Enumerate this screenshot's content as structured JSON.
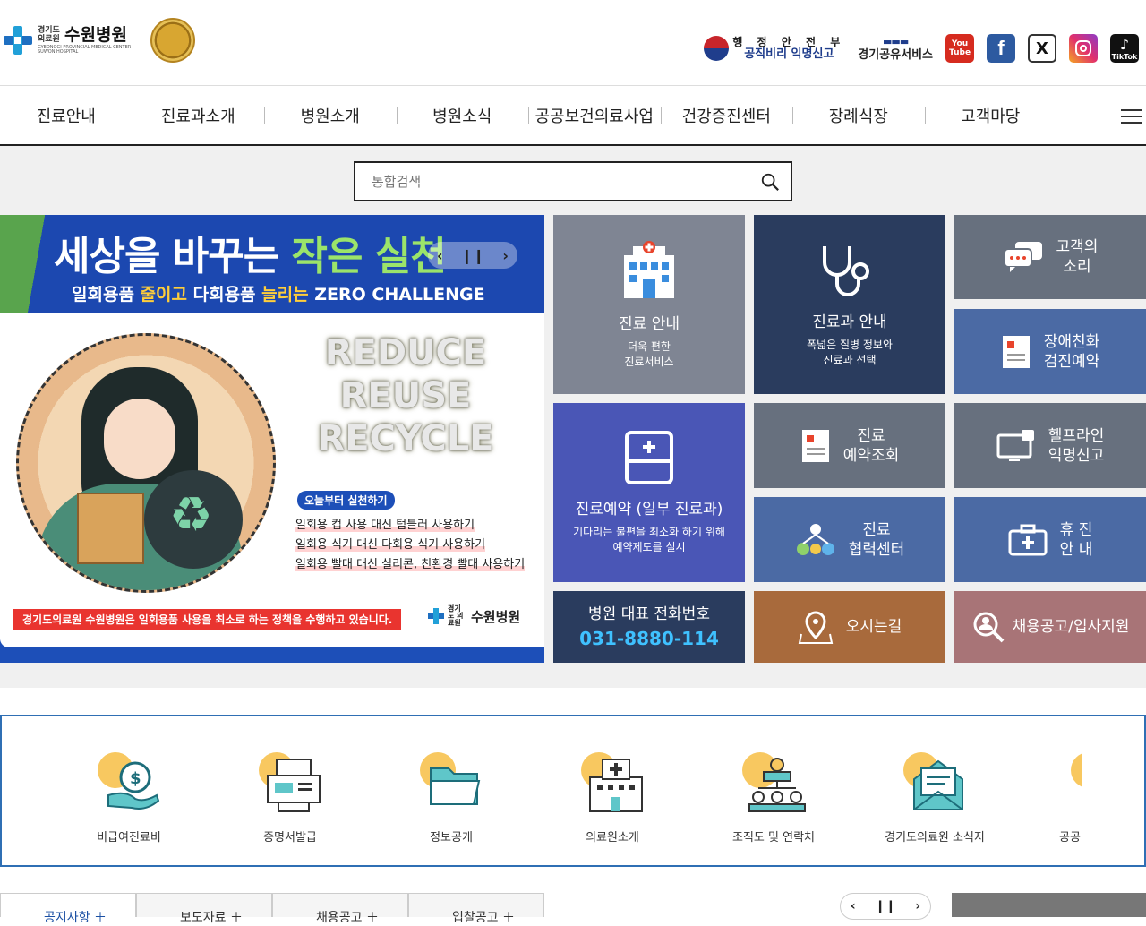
{
  "header": {
    "logo_small": "경기도 의료원",
    "logo_big": "수원병원",
    "logo_en": "GYEONGGI PROVINCIAL MEDICAL CENTER SUWON HOSPITAL",
    "gov_line1": "행 정 안 전 부",
    "gov_line2": "공직비리 익명신고",
    "share_label": "경기공유서비스",
    "youtube": "You Tube",
    "facebook": "f",
    "x": "X",
    "tiktok": "TikTok"
  },
  "nav": {
    "items": [
      "진료안내",
      "진료과소개",
      "병원소개",
      "병원소식",
      "공공보건의료사업",
      "건강증진센터",
      "장례식장",
      "고객마당"
    ]
  },
  "search": {
    "placeholder": "통합검색"
  },
  "banner": {
    "title_a": "세상을 바꾸는 ",
    "title_b": "작은 실천",
    "sub_a": "일회용품 ",
    "sub_b": "줄이고",
    "sub_c": " 다회용품 ",
    "sub_d": "늘리는",
    "sub_e": " ZERO CHALLENGE",
    "rrr": [
      "REDUCE",
      "REUSE",
      "RECYCLE"
    ],
    "today": "오늘부터 실천하기",
    "tips": [
      {
        "a": "일회용 컵 사용 대신 ",
        "b": "텀블러 사용하기"
      },
      {
        "a": "일회용 식기 대신 ",
        "b": "다회용 식기 사용하기"
      },
      {
        "a": "일회용 빨대 대신 ",
        "b": "실리콘, 친환경 빨대 사용하기"
      }
    ],
    "policy": "경기도의료원 수원병원은 일회용품 사용을 최소로 하는 정책을 수행하고 있습니다.",
    "logo_small": "경기도 의료원",
    "logo_big": "수원병원"
  },
  "tiles": {
    "care": {
      "title": "진료 안내",
      "sub1": "더욱 편한",
      "sub2": "진료서비스"
    },
    "dept": {
      "title": "진료과 안내",
      "sub1": "폭넓은 질병 정보와",
      "sub2": "진료과 선택"
    },
    "voice": {
      "l1": "고객의",
      "l2": "소리"
    },
    "friendly": {
      "l1": "장애친화",
      "l2": "검진예약"
    },
    "reserve": {
      "title": "진료예약 (일부 진료과)",
      "sub1": "기다리는 불편을 최소화 하기 위해",
      "sub2": "예약제도를 실시"
    },
    "lookup": {
      "l1": "진료",
      "l2": "예약조회"
    },
    "helpline": {
      "l1": "헬프라인",
      "l2": "익명신고"
    },
    "partner": {
      "l1": "진료",
      "l2": "협력센터"
    },
    "closed": {
      "l1": "휴 진",
      "l2": "안 내"
    },
    "phone": {
      "title": "병원 대표 전화번호",
      "number": "031-8880-114"
    },
    "directions": {
      "label": "오시는길"
    },
    "recruit": {
      "label": "채용공고/입사지원"
    }
  },
  "quick": {
    "items": [
      "비급여진료비",
      "증명서발급",
      "정보공개",
      "의료원소개",
      "조직도 및 연락처",
      "경기도의료원 소식지",
      "공공"
    ]
  },
  "bottom_tabs": [
    "공지사항",
    "보도자료",
    "채용공고",
    "입찰공고"
  ],
  "colors": {
    "accent_blue": "#1d4fb8",
    "nav_line": "#222222",
    "quick_border": "#2f6fb4",
    "phone_number": "#3fc1ff"
  }
}
